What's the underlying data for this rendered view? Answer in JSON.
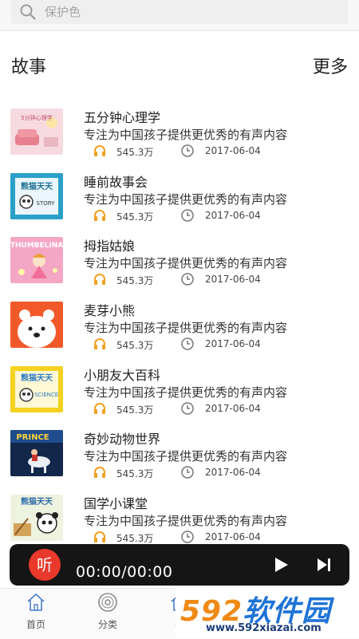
{
  "search": {
    "placeholder": "保护色"
  },
  "section": {
    "title": "故事",
    "more_label": "更多"
  },
  "items": [
    {
      "title": "五分钟心理学",
      "description": "专注为中国孩子提供更优秀的有声内容",
      "plays": "545.3万",
      "date": "2017-06-04"
    },
    {
      "title": "睡前故事会",
      "description": "专注为中国孩子提供更优秀的有声内容",
      "plays": "545.3万",
      "date": "2017-06-04"
    },
    {
      "title": "拇指姑娘",
      "description": "专注为中国孩子提供更优秀的有声内容",
      "plays": "545.3万",
      "date": "2017-06-04"
    },
    {
      "title": "麦芽小熊",
      "description": "专注为中国孩子提供更优秀的有声内容",
      "plays": "545.3万",
      "date": "2017-06-04"
    },
    {
      "title": "小朋友大百科",
      "description": "专注为中国孩子提供更优秀的有声内容",
      "plays": "545.3万",
      "date": "2017-06-04"
    },
    {
      "title": "奇妙动物世界",
      "description": "专注为中国孩子提供更优秀的有声内容",
      "plays": "545.3万",
      "date": "2017-06-04"
    },
    {
      "title": "国学小课堂",
      "description": "专注为中国孩子提供更优秀的有声内容",
      "plays": "545.3万",
      "date": "2017-06-04"
    }
  ],
  "covers": {
    "c0": "5分钟心理学",
    "c1_title": "熊猫天天",
    "c1_sub": "STORY",
    "c2": "THUMBELINA",
    "c4_title": "熊猫天天",
    "c4_sub": "SCIENCE",
    "c5": "PRINCE",
    "c6": "熊猫天天"
  },
  "player": {
    "logo": "听",
    "time": "00:00/00:00"
  },
  "nav": [
    {
      "label": "首页"
    },
    {
      "label": "分类"
    },
    {
      "label": "排"
    }
  ],
  "watermark": {
    "main_a": "592",
    "main_b": "软件园",
    "url": "www.592xiazai.com"
  },
  "colors": {
    "player_bg": "#151515",
    "logo_red": "#e8392a",
    "headphone_orange": "#f0a020",
    "watermark_blue": "#1e73d7",
    "watermark_orange": "#f08a16"
  }
}
